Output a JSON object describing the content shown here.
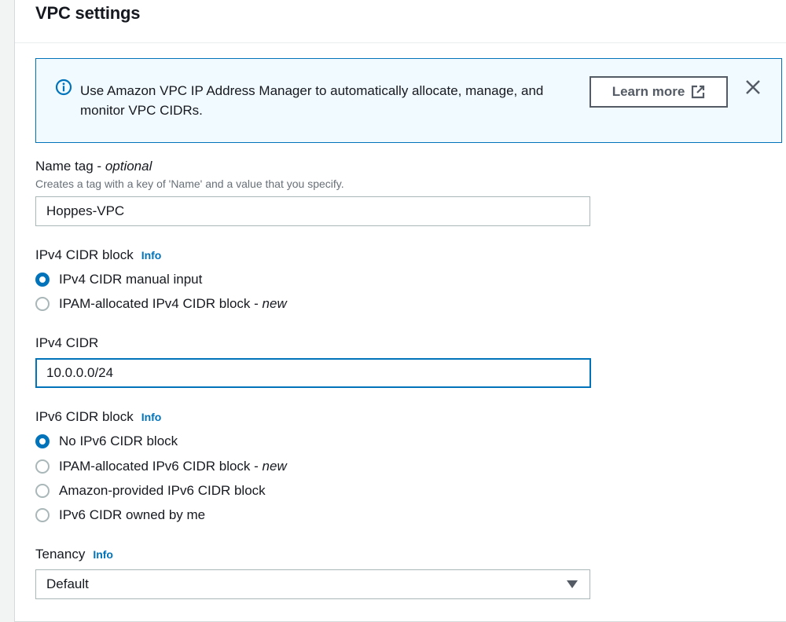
{
  "section": {
    "title": "VPC settings"
  },
  "alert": {
    "text": "Use Amazon VPC IP Address Manager to automatically allocate, manage, and monitor VPC CIDRs.",
    "learn_more_label": "Learn more",
    "icon": "info-circle-icon",
    "accent": "#0073bb"
  },
  "name_tag": {
    "label": "Name tag",
    "optional": "optional",
    "separator": " - ",
    "description": "Creates a tag with a key of 'Name' and a value that you specify.",
    "value": "Hoppes-VPC"
  },
  "ipv4_block": {
    "label": "IPv4 CIDR block",
    "info": "Info",
    "options": [
      {
        "label": "IPv4 CIDR manual input",
        "suffix": "",
        "checked": true
      },
      {
        "label": "IPAM-allocated IPv4 CIDR block",
        "suffix": "new",
        "checked": false
      }
    ]
  },
  "ipv4_cidr": {
    "label": "IPv4 CIDR",
    "value": "10.0.0.0/24"
  },
  "ipv6_block": {
    "label": "IPv6 CIDR block",
    "info": "Info",
    "options": [
      {
        "label": "No IPv6 CIDR block",
        "suffix": "",
        "checked": true
      },
      {
        "label": "IPAM-allocated IPv6 CIDR block",
        "suffix": "new",
        "checked": false
      },
      {
        "label": "Amazon-provided IPv6 CIDR block",
        "suffix": "",
        "checked": false
      },
      {
        "label": "IPv6 CIDR owned by me",
        "suffix": "",
        "checked": false
      }
    ]
  },
  "tenancy": {
    "label": "Tenancy",
    "info": "Info",
    "selected": "Default"
  }
}
